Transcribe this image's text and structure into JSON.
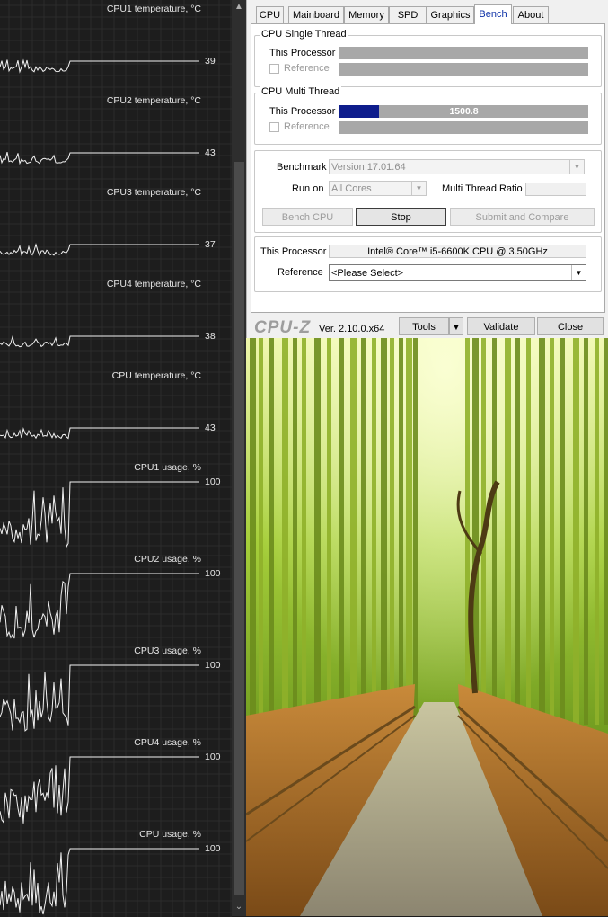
{
  "monitor": {
    "graphs": [
      {
        "title": "CPU1 temperature, °C",
        "value": "39"
      },
      {
        "title": "CPU2 temperature, °C",
        "value": "43"
      },
      {
        "title": "CPU3 temperature, °C",
        "value": "37"
      },
      {
        "title": "CPU4 temperature, °C",
        "value": "38"
      },
      {
        "title": "CPU temperature, °C",
        "value": "43"
      },
      {
        "title": "CPU1 usage, %",
        "value": "100"
      },
      {
        "title": "CPU2 usage, %",
        "value": "100"
      },
      {
        "title": "CPU3 usage, %",
        "value": "100"
      },
      {
        "title": "CPU4 usage, %",
        "value": "100"
      },
      {
        "title": "CPU usage, %",
        "value": "100"
      }
    ],
    "scroll_up_glyph": "▲",
    "scroll_down_glyph": "⌄"
  },
  "cpuz": {
    "tabs": [
      {
        "label": "CPU"
      },
      {
        "label": "Mainboard"
      },
      {
        "label": "Memory"
      },
      {
        "label": "SPD"
      },
      {
        "label": "Graphics"
      },
      {
        "label": "Bench"
      },
      {
        "label": "About"
      }
    ],
    "active_tab": "Bench",
    "single_thread": {
      "title": "CPU Single Thread",
      "this_processor_label": "This Processor",
      "reference_label": "Reference"
    },
    "multi_thread": {
      "title": "CPU Multi Thread",
      "this_processor_label": "This Processor",
      "reference_label": "Reference",
      "score": "1500.8",
      "progress_fraction": 0.16
    },
    "settings": {
      "benchmark_label": "Benchmark",
      "benchmark_value": "Version 17.01.64",
      "run_on_label": "Run on",
      "run_on_value": "All Cores",
      "ratio_label": "Multi Thread Ratio",
      "ratio_value": ""
    },
    "buttons": {
      "bench_cpu": "Bench CPU",
      "stop": "Stop",
      "submit_compare": "Submit and Compare"
    },
    "processor": {
      "this_processor_label": "This Processor",
      "this_processor_value": "Intel® Core™ i5-6600K CPU @ 3.50GHz",
      "reference_label": "Reference",
      "reference_value": "<Please Select>"
    },
    "footer": {
      "logo": "CPU-Z",
      "version": "Ver. 2.10.0.x64",
      "tools": "Tools",
      "tools_arrow": "▼",
      "validate": "Validate",
      "close": "Close"
    },
    "colors": {
      "progress": "#0e1d8c",
      "bar_bg": "#a8a8a8"
    }
  }
}
